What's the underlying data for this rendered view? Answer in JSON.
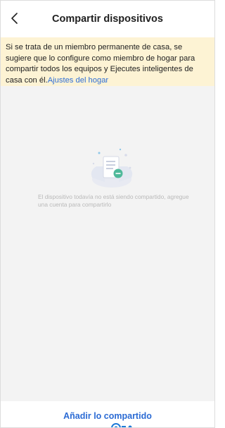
{
  "header": {
    "title": "Compartir dispositivos",
    "back_icon": "chevron-left-icon"
  },
  "notice": {
    "text": "Si se trata de un miembro permanente de casa, se sugiere que lo configure como miembro de hogar para compartir todos los equipos y Ejecutes inteligentes de casa con él.",
    "link": "Ajustes del hogar"
  },
  "empty_state": {
    "illustration_icon": "document-share-icon",
    "message": "El dispositivo todavía no está siendo compartido, agregue una cuenta para compartirlo"
  },
  "footer": {
    "add_label": "Añadir lo compartido"
  },
  "colors": {
    "accent": "#2b6bd4",
    "notice_bg": "#fdf3d4",
    "content_bg": "#f3f3f3"
  }
}
